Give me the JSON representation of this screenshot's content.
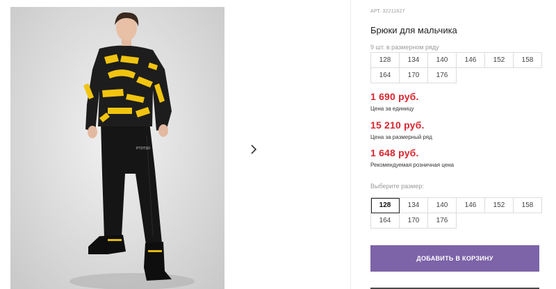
{
  "gallery": {
    "next_icon": "chevron-right-icon",
    "pants_logo": "PTDTSD"
  },
  "product": {
    "article": "АРТ. 32211627",
    "title": "Брюки для мальчика",
    "pack_caption": "9 шт. в размерном ряду",
    "pack_sizes": [
      "128",
      "134",
      "140",
      "146",
      "152",
      "158",
      "164",
      "170",
      "176"
    ],
    "prices": [
      {
        "value": "1 690 руб.",
        "label": "Цена за единицу"
      },
      {
        "value": "15 210 руб.",
        "label": "Цена за размерный ряд"
      },
      {
        "value": "1 648 руб.",
        "label": "Рекомендуемая розничная цена"
      }
    ],
    "choose_caption": "Выберите размер:",
    "selected_size": "128",
    "add_to_cart": "ДОБАВИТЬ В КОРЗИНУ"
  },
  "colors": {
    "accent_button": "#7d63a8",
    "price_red": "#d7262f"
  }
}
